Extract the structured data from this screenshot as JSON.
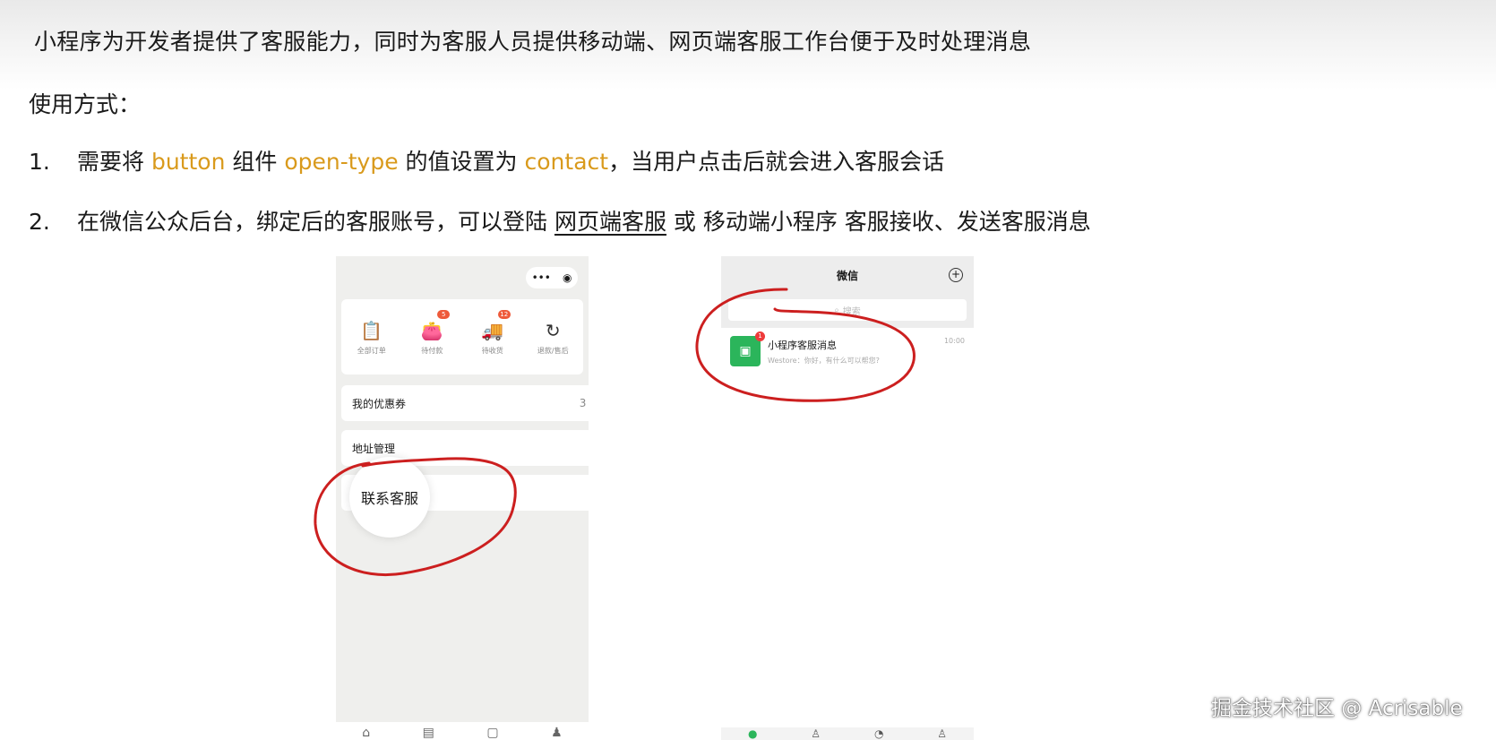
{
  "slide": {
    "headline": "小程序为开发者提供了客服能力，同时为客服人员提供移动端、网页端客服工作台便于及时处理消息",
    "usage_label": "使用方式：",
    "step1": {
      "num": "1.",
      "t1": "需要将 ",
      "k1": "button",
      "t2": " 组件 ",
      "k2": "open-type",
      "t3": " 的值设置为 ",
      "k3": "contact",
      "t4": "，当用户点击后就会进入客服会话"
    },
    "step2": {
      "num": "2.",
      "t1": "在微信公众后台，绑定后的客服账号，可以登陆 ",
      "link": "网页端客服",
      "t2": " 或 移动端小程序 客服接收、发送客服消息"
    },
    "highlight_color": "#d99a1c"
  },
  "phone_mine": {
    "capsule": {
      "menu": "•••",
      "close": "◉"
    },
    "orders": [
      {
        "label": "全部订单",
        "icon": "clipboard-icon",
        "glyph": "📋",
        "badge": ""
      },
      {
        "label": "待付款",
        "icon": "wallet-icon",
        "glyph": "👛",
        "badge": "5"
      },
      {
        "label": "待收货",
        "icon": "truck-icon",
        "glyph": "🚚",
        "badge": "12"
      },
      {
        "label": "退款/售后",
        "icon": "refund-icon",
        "glyph": "↻",
        "badge": ""
      }
    ],
    "coupon_label": "我的优惠券",
    "coupon_count": "3",
    "address_label": "地址管理",
    "contact_label": "联系客服",
    "chevron": "›",
    "tabbar": [
      "⌂",
      "▤",
      "▢",
      "♟"
    ]
  },
  "phone_wechat": {
    "title": "微信",
    "plus": "+",
    "search_placeholder": "搜索",
    "chat": {
      "title": "小程序客服消息",
      "preview": "Westore：你好，有什么可以帮您?",
      "time": "10:00",
      "badge": "1"
    },
    "tabbar": [
      "●",
      "♙",
      "◔",
      "♙"
    ]
  },
  "watermark": "掘金技术社区 @ Acrisable",
  "annotation_color": "#cc1f1f"
}
